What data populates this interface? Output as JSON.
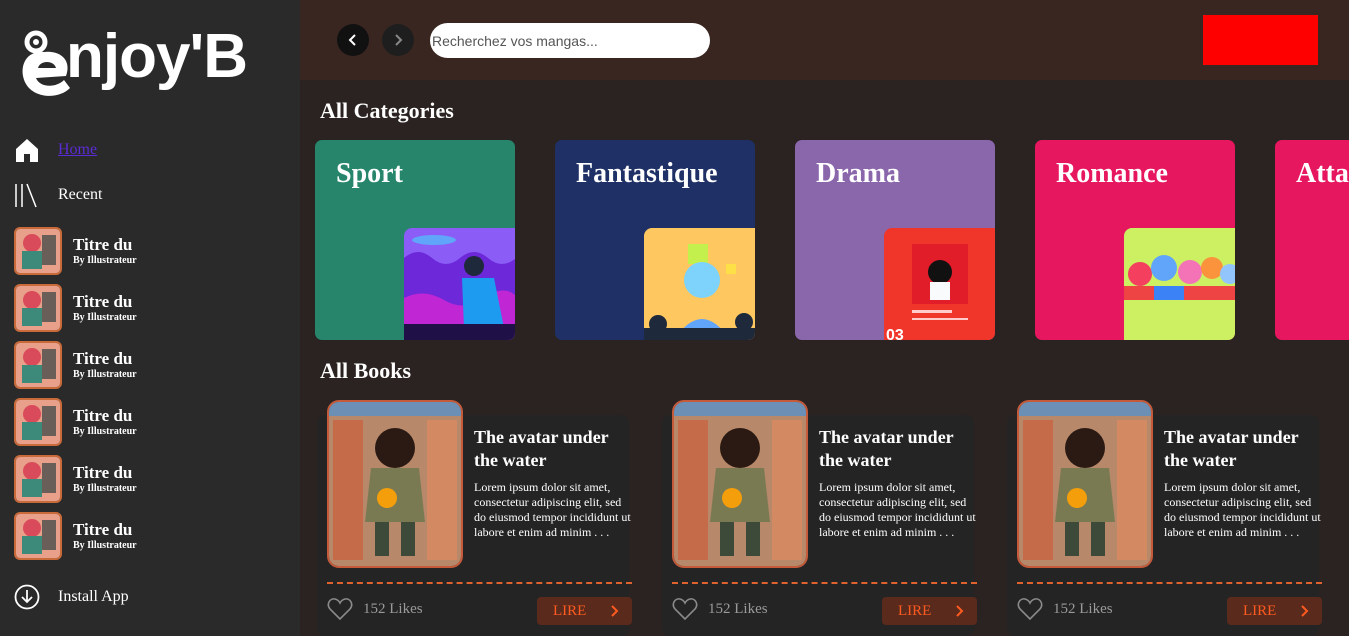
{
  "brand": {
    "name": "njoy'B"
  },
  "sidebar": {
    "nav": [
      {
        "label": "Home",
        "icon": "home-icon"
      },
      {
        "label": "Recent",
        "icon": "library-icon"
      }
    ],
    "recent": [
      {
        "title": "Titre du",
        "author": "By Illustrateur"
      },
      {
        "title": "Titre du",
        "author": "By Illustrateur"
      },
      {
        "title": "Titre du",
        "author": "By Illustrateur"
      },
      {
        "title": "Titre du",
        "author": "By Illustrateur"
      },
      {
        "title": "Titre du",
        "author": "By Illustrateur"
      },
      {
        "title": "Titre du",
        "author": "By Illustrateur"
      }
    ],
    "install_label": "Install App"
  },
  "header": {
    "search_placeholder": "Recherchez vos mangas...",
    "profile_color": "#ff0000"
  },
  "categories": {
    "title": "All Categories",
    "items": [
      {
        "name": "Sport",
        "color": "#26856a",
        "art_bg": "#8b5cf6"
      },
      {
        "name": "Fantastique",
        "color": "#1f3066",
        "art_bg": "#ffc75f"
      },
      {
        "name": "Drama",
        "color": "#8a66ab",
        "art_bg": "#f0352a"
      },
      {
        "name": "Romance",
        "color": "#e6165f",
        "art_bg": "#cdef62"
      },
      {
        "name": "Atta",
        "color": "#e6165f",
        "art_bg": "#e6165f"
      }
    ]
  },
  "books": {
    "title": "All Books",
    "items": [
      {
        "title": "The avatar under the water",
        "desc": "Lorem ipsum dolor sit amet, consectetur adipiscing elit, sed do eiusmod tempor incididunt ut labore et enim ad minim . . .",
        "likes": "152 Likes",
        "cta": "LIRE"
      },
      {
        "title": "The avatar under the water",
        "desc": "Lorem ipsum dolor sit amet, consectetur adipiscing elit, sed do eiusmod tempor incididunt ut labore et enim ad minim . . .",
        "likes": "152 Likes",
        "cta": "LIRE"
      },
      {
        "title": "The avatar under the water",
        "desc": "Lorem ipsum dolor sit amet, consectetur adipiscing elit, sed do eiusmod tempor incididunt ut labore et enim ad minim . . .",
        "likes": "152 Likes",
        "cta": "LIRE"
      }
    ]
  },
  "colors": {
    "accent": "#e0632f",
    "lire_bg": "#5a2a1c",
    "lire_text": "#ff5a1f",
    "link": "#5b2bd6"
  }
}
